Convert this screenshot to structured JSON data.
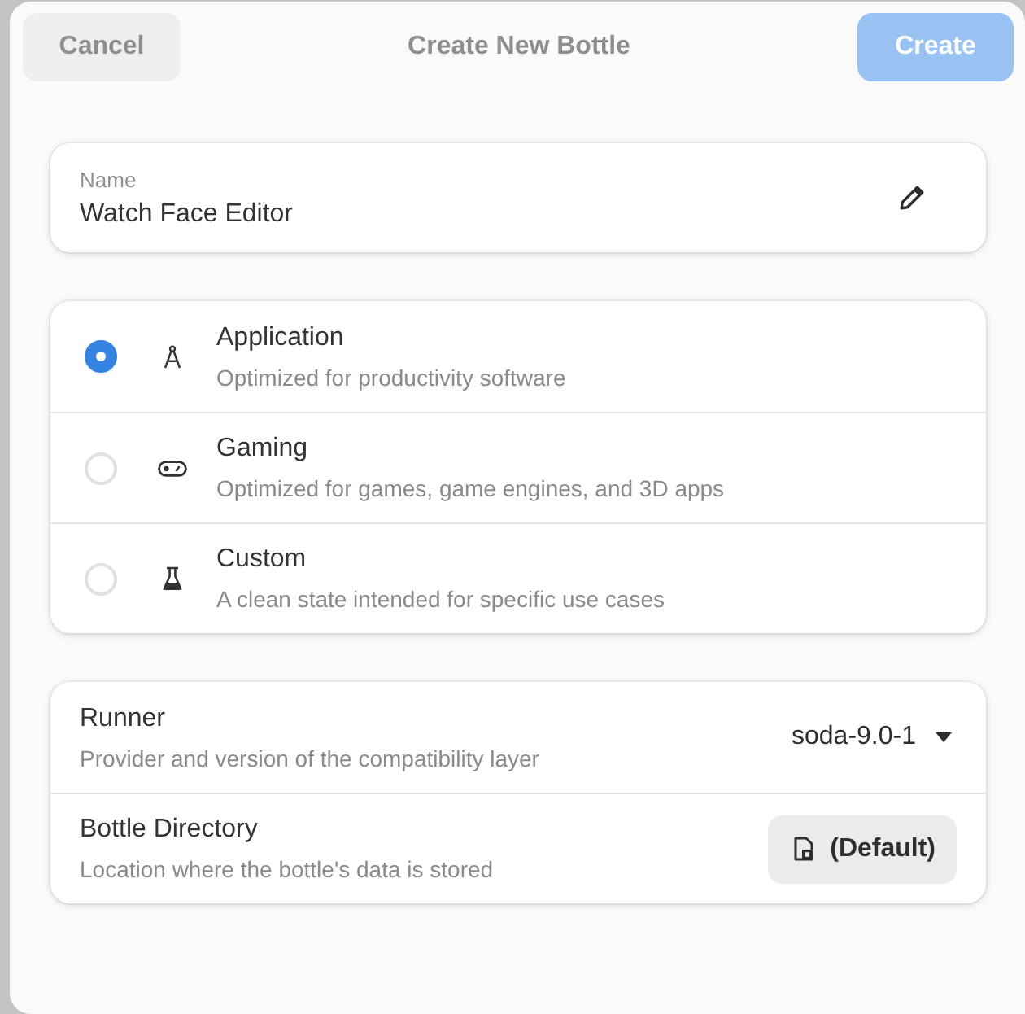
{
  "header": {
    "cancel": "Cancel",
    "title": "Create New Bottle",
    "create": {
      "label": "Create",
      "disabled": true
    }
  },
  "name_field": {
    "label": "Name",
    "value": "Watch Face Editor"
  },
  "environments": [
    {
      "title": "Application",
      "subtitle": "Optimized for productivity software",
      "selected": true
    },
    {
      "title": "Gaming",
      "subtitle": "Optimized for games, game engines, and 3D apps",
      "selected": false
    },
    {
      "title": "Custom",
      "subtitle": "A clean state intended for specific use cases",
      "selected": false
    }
  ],
  "settings": [
    {
      "kind": "dropdown",
      "title": "Runner",
      "subtitle": "Provider and version of the compatibility layer",
      "value": "soda-9.0-1"
    },
    {
      "kind": "button",
      "title": "Bottle Directory",
      "subtitle": "Location where the bottle's data is stored",
      "value": "(Default)"
    }
  ]
}
